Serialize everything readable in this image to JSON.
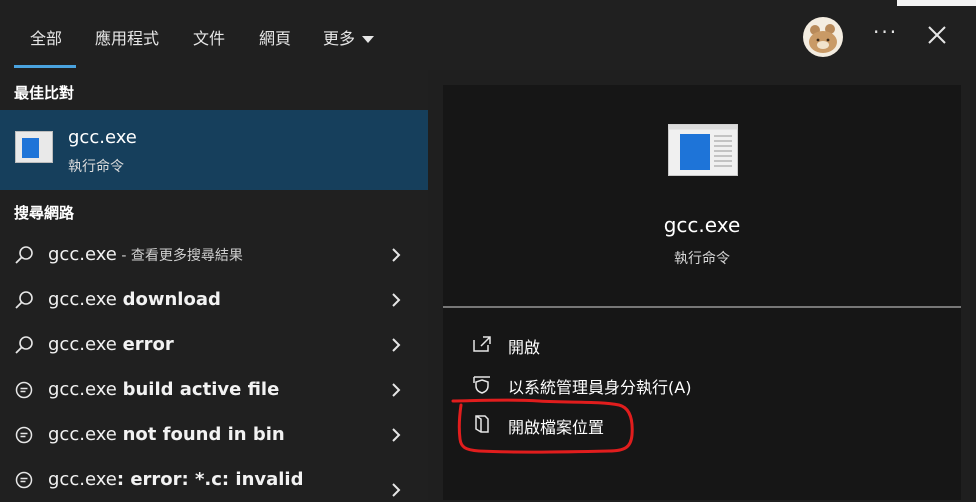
{
  "tabs": [
    {
      "label": "全部"
    },
    {
      "label": "應用程式"
    },
    {
      "label": "文件"
    },
    {
      "label": "網頁"
    },
    {
      "label": "更多"
    }
  ],
  "header": {
    "more_label": "···"
  },
  "sections": {
    "best_match": "最佳比對",
    "search_web": "搜尋網路"
  },
  "best_match": {
    "name": "gcc.exe",
    "type": "執行命令"
  },
  "web_results": [
    {
      "prefix": "gcc.exe",
      "suffix": " - 查看更多搜尋結果",
      "icon": "search-icon"
    },
    {
      "prefix": "gcc.exe ",
      "suffix": "download",
      "icon": "search-icon"
    },
    {
      "prefix": "gcc.exe ",
      "suffix": "error",
      "icon": "search-icon"
    },
    {
      "prefix": "gcc.exe ",
      "suffix": "build active file",
      "icon": "chat-icon"
    },
    {
      "prefix": "gcc.exe ",
      "suffix": "not found in bin",
      "icon": "chat-icon"
    },
    {
      "prefix": "gcc.exe",
      "suffix": ": error: *.c: invalid",
      "icon": "chat-icon"
    }
  ],
  "preview": {
    "name": "gcc.exe",
    "type": "執行命令"
  },
  "actions": [
    {
      "label": "開啟",
      "icon": "open-icon"
    },
    {
      "label": "以系統管理員身分執行(A)",
      "icon": "shield-icon"
    },
    {
      "label": "開啟檔案位置",
      "icon": "folder-icon"
    }
  ],
  "colors": {
    "accent": "#4aa3df",
    "selected_bg": "#163f5c",
    "annotation": "#e11d1d"
  }
}
